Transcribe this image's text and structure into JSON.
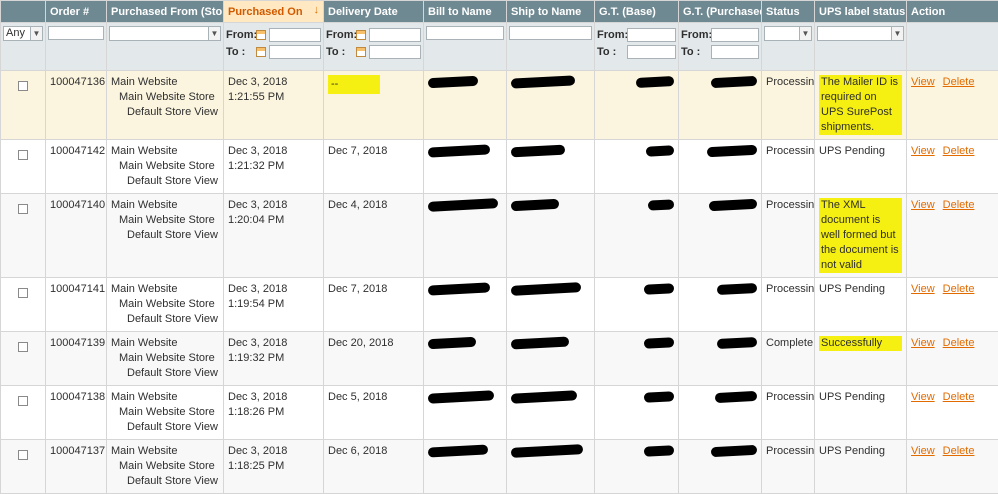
{
  "headers": {
    "order": "Order #",
    "store": "Purchased From (Store)",
    "purchased_on": "Purchased On",
    "delivery": "Delivery Date",
    "bill": "Bill to Name",
    "ship": "Ship to Name",
    "gt_base": "G.T. (Base)",
    "gt_purchased": "G.T. (Purchased)",
    "status": "Status",
    "ups": "UPS label status",
    "action": "Action"
  },
  "filters": {
    "any": "Any",
    "from": "From:",
    "to": "To :"
  },
  "actions": {
    "view": "View",
    "delete": "Delete"
  },
  "rows": [
    {
      "order": "100047136",
      "store": [
        "Main Website",
        "Main Website Store",
        "Default Store View"
      ],
      "purchased": "Dec 3, 2018 1:21:55 PM",
      "delivery": "--",
      "status": "Processing",
      "ups": "The Mailer ID is required on UPS SurePost shipments."
    },
    {
      "order": "100047142",
      "store": [
        "Main Website",
        "Main Website Store",
        "Default Store View"
      ],
      "purchased": "Dec 3, 2018 1:21:32 PM",
      "delivery": "Dec 7, 2018",
      "status": "Processing",
      "ups": "UPS Pending"
    },
    {
      "order": "100047140",
      "store": [
        "Main Website",
        "Main Website Store",
        "Default Store View"
      ],
      "purchased": "Dec 3, 2018 1:20:04 PM",
      "delivery": "Dec 4, 2018",
      "status": "Processing",
      "ups": "The XML document is well formed but the document is not valid"
    },
    {
      "order": "100047141",
      "store": [
        "Main Website",
        "Main Website Store",
        "Default Store View"
      ],
      "purchased": "Dec 3, 2018 1:19:54 PM",
      "delivery": "Dec 7, 2018",
      "status": "Processing",
      "ups": "UPS Pending"
    },
    {
      "order": "100047139",
      "store": [
        "Main Website",
        "Main Website Store",
        "Default Store View"
      ],
      "purchased": "Dec 3, 2018 1:19:32 PM",
      "delivery": "Dec 20, 2018",
      "status": "Complete",
      "ups": "Successfully"
    },
    {
      "order": "100047138",
      "store": [
        "Main Website",
        "Main Website Store",
        "Default Store View"
      ],
      "purchased": "Dec 3, 2018 1:18:26 PM",
      "delivery": "Dec 5, 2018",
      "status": "Processing",
      "ups": "UPS Pending"
    },
    {
      "order": "100047137",
      "store": [
        "Main Website",
        "Main Website Store",
        "Default Store View"
      ],
      "purchased": "Dec 3, 2018 1:18:25 PM",
      "delivery": "Dec 6, 2018",
      "status": "Processing",
      "ups": "UPS Pending"
    }
  ],
  "colors": {
    "header_bg": "#6f8992",
    "sorted_header_bg": "#ffe8c2",
    "highlight": "#f6f012",
    "link": "#e26b00"
  }
}
